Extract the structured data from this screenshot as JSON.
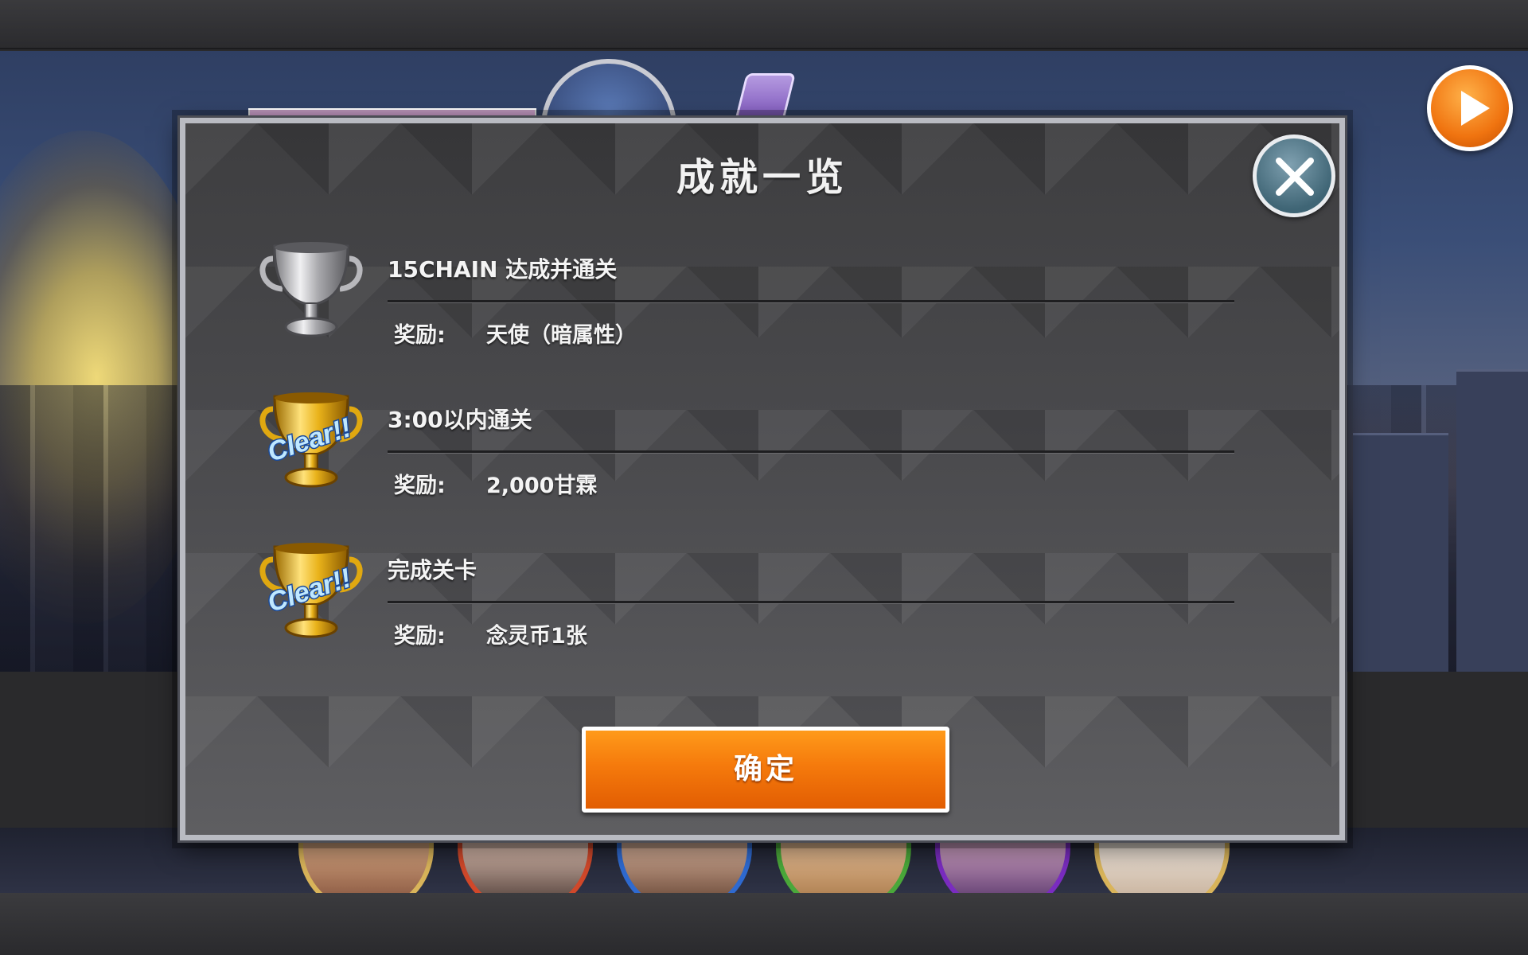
{
  "modal": {
    "title": "成就一览",
    "confirm_label": "确定"
  },
  "achievements": [
    {
      "title": "15CHAIN 达成并通关",
      "reward_label": "奖励:",
      "reward_value": "天使（暗属性）",
      "trophy": "silver",
      "cleared": false
    },
    {
      "title": "3:00以内通关",
      "reward_label": "奖励:",
      "reward_value": "2,000甘霖",
      "trophy": "gold",
      "cleared": true,
      "badge": "Clear!!"
    },
    {
      "title": "完成关卡",
      "reward_label": "奖励:",
      "reward_value": "念灵币1张",
      "trophy": "gold",
      "cleared": true,
      "badge": "Clear!!"
    }
  ],
  "icons": {
    "close": "close-icon",
    "play": "play-icon",
    "silver_trophy": "silver-trophy-icon",
    "gold_trophy": "gold-trophy-icon"
  },
  "colors": {
    "confirm_button": "#f57a0c",
    "close_button": "#3f6575",
    "gold": "#e9b21a",
    "silver": "#b8b8bc"
  }
}
